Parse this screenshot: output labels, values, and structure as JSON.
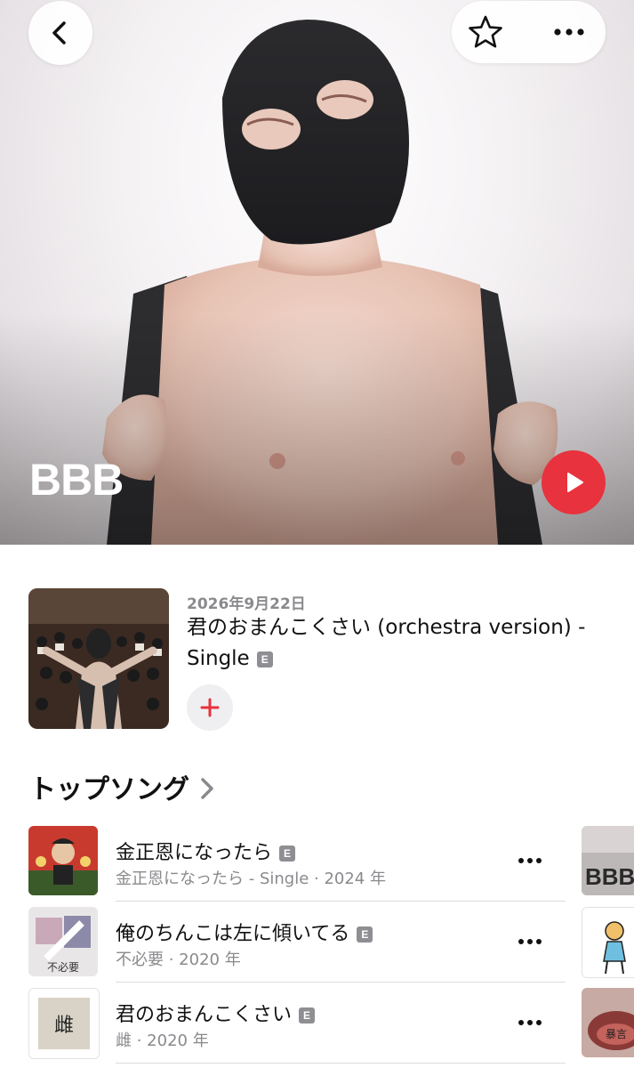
{
  "artist": {
    "name": "BBB"
  },
  "header": {
    "back_icon": "chevron-left-icon",
    "favorite_icon": "star-icon",
    "more_icon": "ellipsis-icon"
  },
  "colors": {
    "accent": "#e8323e",
    "secondary_text": "#8a8a8e",
    "badge": "#8e8e93"
  },
  "latest_release": {
    "date": "2026年9月22日",
    "title": "君のおまんこくさい (orchestra version) - Single",
    "explicit_badge": "E",
    "add_icon": "plus-icon"
  },
  "top_songs": {
    "title": "トップソング",
    "songs": [
      {
        "title": "金正恩になったら",
        "explicit": "E",
        "subtitle": "金正恩になったら - Single · 2024 年"
      },
      {
        "title": "俺のちんこは左に傾いてる",
        "explicit": "E",
        "subtitle": "不必要 · 2020 年"
      },
      {
        "title": "君のおまんこくさい",
        "explicit": "E",
        "subtitle": "雌 · 2020 年"
      }
    ]
  },
  "artwork_text": {
    "song2_art": "不必要",
    "song3_art": "雌",
    "side1_art": "BBB",
    "side3_art": "暴言"
  }
}
